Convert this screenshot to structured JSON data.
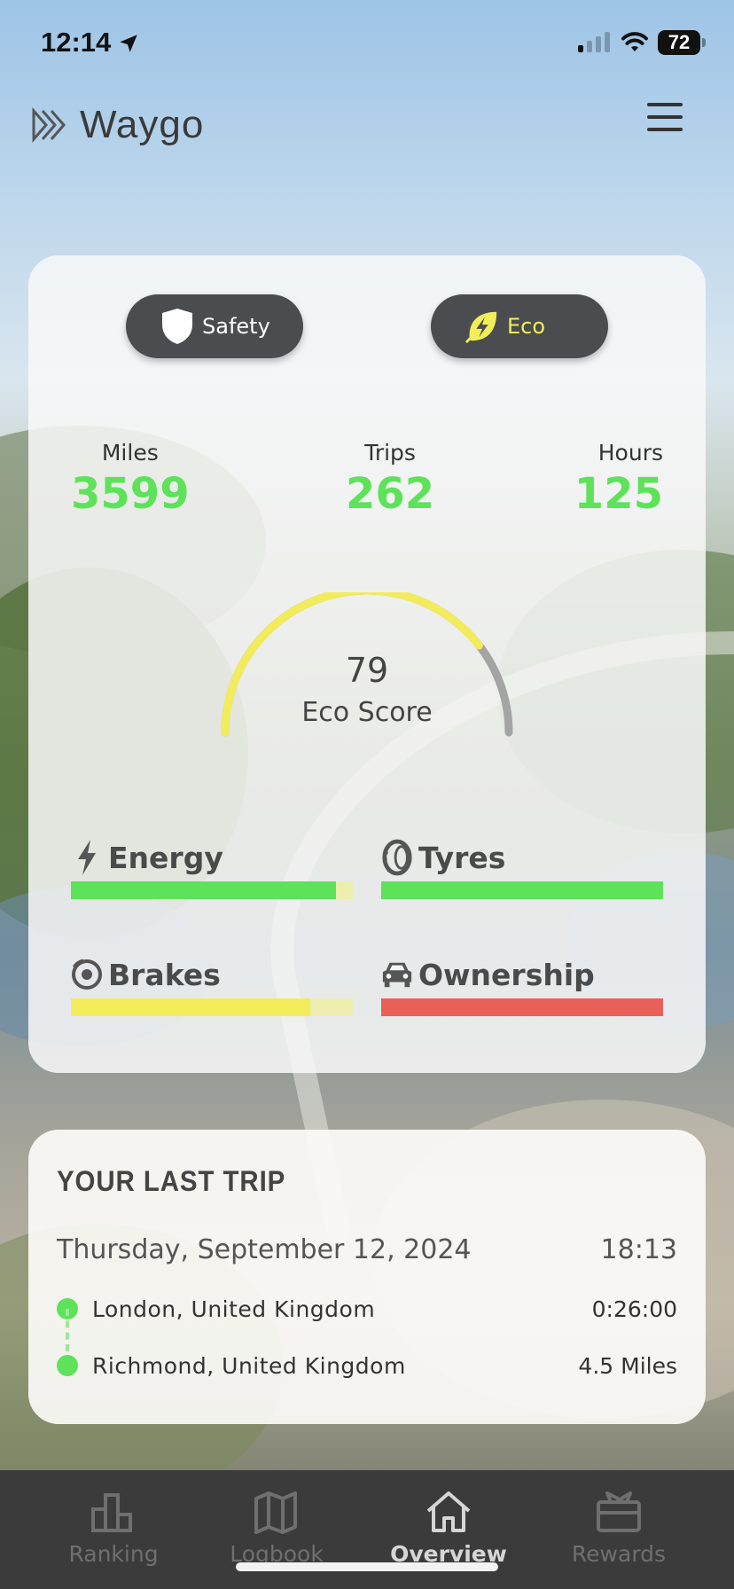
{
  "status_bar": {
    "time": "12:14",
    "battery": "72"
  },
  "header": {
    "app_name": "Waygo",
    "icons": [
      "logo-chevrons",
      "hamburger-menu"
    ]
  },
  "score_card": {
    "modes": [
      {
        "label": "Safety",
        "icon": "shield-icon",
        "selected": false
      },
      {
        "label": "Eco",
        "icon": "leaf-bolt-icon",
        "selected": true
      }
    ],
    "stats": {
      "miles": {
        "label": "Miles",
        "value": "3599"
      },
      "trips": {
        "label": "Trips",
        "value": "262"
      },
      "hours": {
        "label": "Hours",
        "value": "125"
      }
    },
    "gauge": {
      "value": "79",
      "label": "Eco Score",
      "fraction": 0.79
    },
    "metrics": [
      {
        "label": "Energy",
        "icon": "lightning-icon",
        "fraction": 0.94,
        "color": "#5de25a",
        "track": "#eeeeb0"
      },
      {
        "label": "Tyres",
        "icon": "tyre-icon",
        "fraction": 1.0,
        "color": "#5de25a",
        "track": "#eeeeb0"
      },
      {
        "label": "Brakes",
        "icon": "brake-disc-icon",
        "fraction": 0.85,
        "color": "#f2ec5c",
        "track": "#eeeeb0"
      },
      {
        "label": "Ownership",
        "icon": "car-icon",
        "fraction": 1.0,
        "color": "#e9605a",
        "track": "#eeeeb0"
      }
    ]
  },
  "last_trip": {
    "title": "YOUR LAST TRIP",
    "date": "Thursday, September 12, 2024",
    "time": "18:13",
    "origin": "London, United Kingdom",
    "duration": "0:26:00",
    "destination": "Richmond, United Kingdom",
    "distance": "4.5 Miles"
  },
  "tab_bar": {
    "tabs": [
      {
        "label": "Ranking",
        "icon": "bar-chart-icon",
        "active": false
      },
      {
        "label": "Logbook",
        "icon": "map-icon",
        "active": false
      },
      {
        "label": "Overview",
        "icon": "home-icon",
        "active": true
      },
      {
        "label": "Rewards",
        "icon": "gift-icon",
        "active": false
      }
    ]
  },
  "colors": {
    "accent_green": "#5de25a",
    "accent_yellow": "#f2ec5c",
    "alert_red": "#e9605a",
    "toggle_bg": "#4a4c50",
    "tab_bar_bg": "#3b3b3b"
  }
}
